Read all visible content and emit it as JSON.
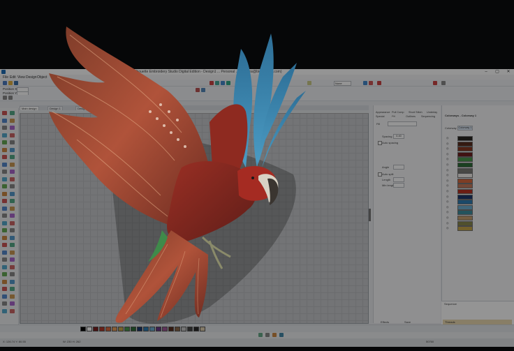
{
  "window": {
    "title": "Silhouette Embroidery Studio Digital Edition - Design1 ... Personal ... (designs@bigdesigns.com)"
  },
  "menu": [
    "File",
    "Edit",
    "View",
    "Design",
    "Object"
  ],
  "toolbar": {
    "position_x_label": "Position X",
    "position_x_value": "",
    "position_y_label": "Position Y",
    "position_y_value": "",
    "zoom_value": "None"
  },
  "canvas_tabs": [
    "Main design",
    "Design 1",
    "Design 2",
    "Design 3",
    "Design 4",
    "Design 5"
  ],
  "properties": {
    "tabs": [
      "Appearance",
      "Pull Comp",
      "Short Stitch",
      "Underlay",
      "Special",
      "Fill",
      "Outlines",
      "Sequencing"
    ],
    "fill_label": "Fill",
    "spacing_label": "Spacing",
    "spacing_value": "0.40",
    "auto_spacing_label": "Auto spacing",
    "angle_label": "Angle",
    "angle_value": "",
    "auto_split_label": "Auto split",
    "length_label": "Length",
    "length_value": "",
    "min_length_label": "Min length",
    "min_length_value": "",
    "effects_label": "Effects",
    "save_label": "Save"
  },
  "colorways": {
    "header": "Colorways - Colorway 1",
    "colorway_label": "Colorway",
    "colorway_value": "Colorway 1",
    "swatches": [
      {
        "name": "Black",
        "color": "#2a2622"
      },
      {
        "name": "Brown",
        "color": "#5a2e1e"
      },
      {
        "name": "Rust",
        "color": "#8a3a24"
      },
      {
        "name": "Dark Red",
        "color": "#6e2020"
      },
      {
        "name": "Green",
        "color": "#4a9a4e"
      },
      {
        "name": "Dark Green",
        "color": "#2f6e3a"
      },
      {
        "name": "Gray",
        "color": "#7c7c78"
      },
      {
        "name": "White",
        "color": "#f4f2ee"
      },
      {
        "name": "Orange",
        "color": "#d96a3e"
      },
      {
        "name": "Salmon",
        "color": "#c77a5e"
      },
      {
        "name": "Red",
        "color": "#b83224"
      },
      {
        "name": "Navy",
        "color": "#1d3a6e"
      },
      {
        "name": "Blue",
        "color": "#2f7fb5"
      },
      {
        "name": "Light Blue",
        "color": "#6fb0d2"
      },
      {
        "name": "Teal",
        "color": "#3d8fa0"
      },
      {
        "name": "Tan",
        "color": "#c8a070"
      },
      {
        "name": "Olive",
        "color": "#8a8a4e"
      },
      {
        "name": "Gold",
        "color": "#c9a84a"
      }
    ]
  },
  "sequence": {
    "header": "Sequence",
    "threads_label": "Threads"
  },
  "palette": [
    "#000000",
    "#ffffff",
    "#7a1e1e",
    "#b33a2a",
    "#d96a3e",
    "#e8a060",
    "#c9a84a",
    "#4a9a4e",
    "#2f6e3a",
    "#1d3a6e",
    "#2f7fb5",
    "#6fb0d2",
    "#6a3a8a",
    "#a05a9a",
    "#5a2e1e",
    "#8a6a4a",
    "#c8c8c8",
    "#444444",
    "#2a2a2a",
    "#e0d0b0"
  ],
  "status": {
    "coords": "X: 126.74 Y: 60.55",
    "size": "W: 230 H: 262",
    "stitches": "50760"
  }
}
